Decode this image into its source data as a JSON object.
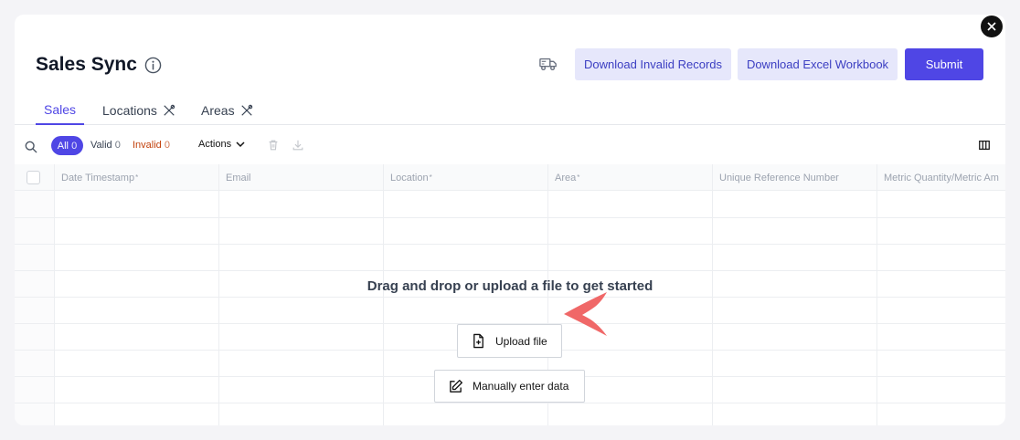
{
  "header": {
    "title": "Sales Sync",
    "buttons": {
      "download_invalid": "Download Invalid Records",
      "download_workbook": "Download Excel Workbook",
      "submit": "Submit"
    }
  },
  "tabs": [
    {
      "label": "Sales"
    },
    {
      "label": "Locations"
    },
    {
      "label": "Areas"
    }
  ],
  "toolbar": {
    "filters": {
      "all_label": "All",
      "all_count": "0",
      "valid_label": "Valid",
      "valid_count": "0",
      "invalid_label": "Invalid",
      "invalid_count": "0"
    },
    "actions_label": "Actions"
  },
  "grid": {
    "columns": [
      {
        "label": "Date Timestamp",
        "required": "*"
      },
      {
        "label": "Email",
        "required": ""
      },
      {
        "label": "Location",
        "required": "*"
      },
      {
        "label": "Area",
        "required": "*"
      },
      {
        "label": "Unique Reference Number",
        "required": ""
      },
      {
        "label": "Metric Quantity/Metric Am",
        "required": ""
      }
    ]
  },
  "empty_state": {
    "message": "Drag and drop or upload a file to get started",
    "upload_label": "Upload file",
    "manual_label": "Manually enter data"
  },
  "colors": {
    "primary": "#4f46e5",
    "secondary_bg": "#e6e7fb",
    "invalid": "#c2410c",
    "arrow": "#f06868"
  },
  "icons": [
    "close-icon",
    "info-icon",
    "truck-icon",
    "search-icon",
    "chevron-down-icon",
    "trash-icon",
    "download-icon",
    "columns-icon",
    "tools-icon",
    "file-plus-icon",
    "edit-icon",
    "arrow-pointer-icon"
  ]
}
